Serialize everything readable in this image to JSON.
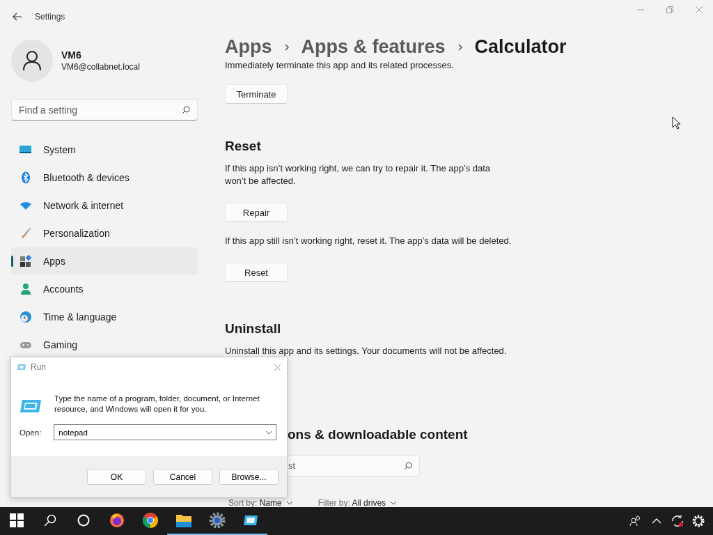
{
  "window": {
    "title": "Settings"
  },
  "user": {
    "name": "VM6",
    "email": "VM6@collabnet.local"
  },
  "search": {
    "placeholder": "Find a setting"
  },
  "nav": [
    {
      "label": "System",
      "kind": "system",
      "selected": false
    },
    {
      "label": "Bluetooth & devices",
      "kind": "bluetooth",
      "selected": false
    },
    {
      "label": "Network & internet",
      "kind": "network",
      "selected": false
    },
    {
      "label": "Personalization",
      "kind": "brush",
      "selected": false
    },
    {
      "label": "Apps",
      "kind": "apps",
      "selected": true
    },
    {
      "label": "Accounts",
      "kind": "accounts",
      "selected": false
    },
    {
      "label": "Time & language",
      "kind": "time",
      "selected": false
    },
    {
      "label": "Gaming",
      "kind": "gaming",
      "selected": false
    }
  ],
  "breadcrumb": [
    "Apps",
    "Apps & features",
    "Calculator"
  ],
  "terminate": {
    "description": "Immediately terminate this app and its related processes.",
    "button": "Terminate"
  },
  "reset": {
    "heading": "Reset",
    "repair_text": "If this app isn’t working right, we can try to repair it. The app’s data won’t be affected.",
    "repair_button": "Repair",
    "reset_text": "If this app still isn’t working right, reset it. The app’s data will be deleted.",
    "reset_button": "Reset"
  },
  "uninstall": {
    "heading": "Uninstall",
    "description": "Uninstall this app and its settings. Your documents will not be affected."
  },
  "addons": {
    "heading": "ons & downloadable content",
    "search_placeholder": "st",
    "sort_label": "Sort by:",
    "sort_value": "Name",
    "filter_label": "Filter by:",
    "filter_value": "All drives"
  },
  "run_dialog": {
    "title": "Run",
    "message": "Type the name of a program, folder, document, or Internet resource, and Windows will open it for you.",
    "open_label": "Open:",
    "value": "notepad",
    "buttons": [
      "OK",
      "Cancel",
      "Browse..."
    ]
  },
  "taskbar": {
    "apps": [
      {
        "kind": "firefox",
        "active": false
      },
      {
        "kind": "chrome",
        "active": false
      },
      {
        "kind": "explorer",
        "active": true
      },
      {
        "kind": "settings",
        "active": true
      },
      {
        "kind": "run",
        "active": true
      }
    ]
  }
}
